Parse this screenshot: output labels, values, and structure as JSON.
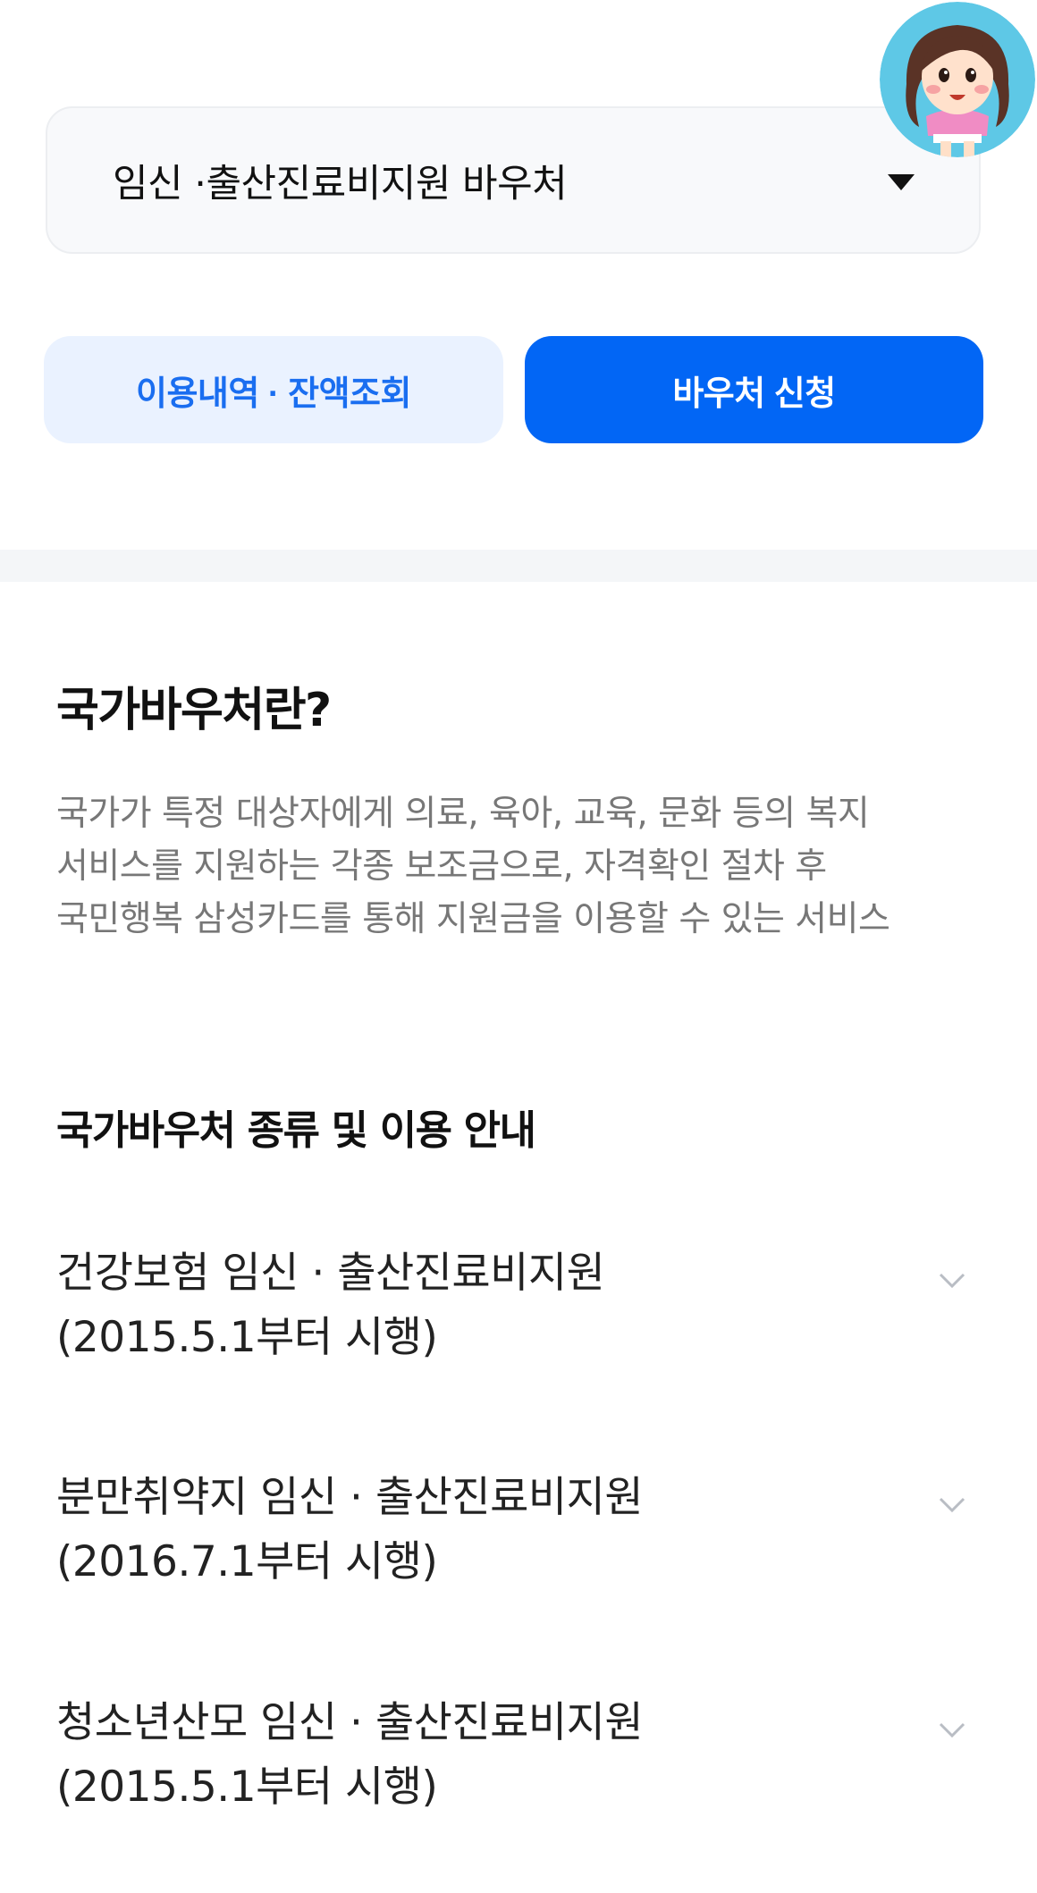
{
  "voucher_select": {
    "selected": "임신 ·출산진료비지원 바우처"
  },
  "buttons": {
    "history": "이용내역 · 잔액조회",
    "apply": "바우처 신청"
  },
  "info": {
    "title": "국가바우처란?",
    "description": "국가가 특정 대상자에게 의료, 육아, 교육, 문화 등의 복지 서비스를 지원하는 각종 보조금으로, 자격확인 절차 후 국민행복 삼성카드를 통해 지원금을 이용할 수 있는 서비스"
  },
  "voucher_list": {
    "title": "국가바우처 종류 및 이용 안내",
    "items": [
      {
        "name": "건강보험 임신 · 출산진료비지원",
        "date": "(2015.5.1부터 시행)"
      },
      {
        "name": "분만취약지 임신 · 출산진료비지원",
        "date": "(2016.7.1부터 시행)"
      },
      {
        "name": "청소년산모 임신 · 출산진료비지원",
        "date": "(2015.5.1부터 시행)"
      }
    ]
  },
  "icons": {
    "select_caret": "caret-down-icon",
    "accordion": "chevron-down-icon",
    "avatar": "avatar-illustration"
  },
  "colors": {
    "primary": "#0266f5",
    "primary_light_bg": "#eaf2ff",
    "primary_light_text": "#1a6ef0",
    "muted_text": "#777777",
    "divider": "#f4f6f8"
  }
}
